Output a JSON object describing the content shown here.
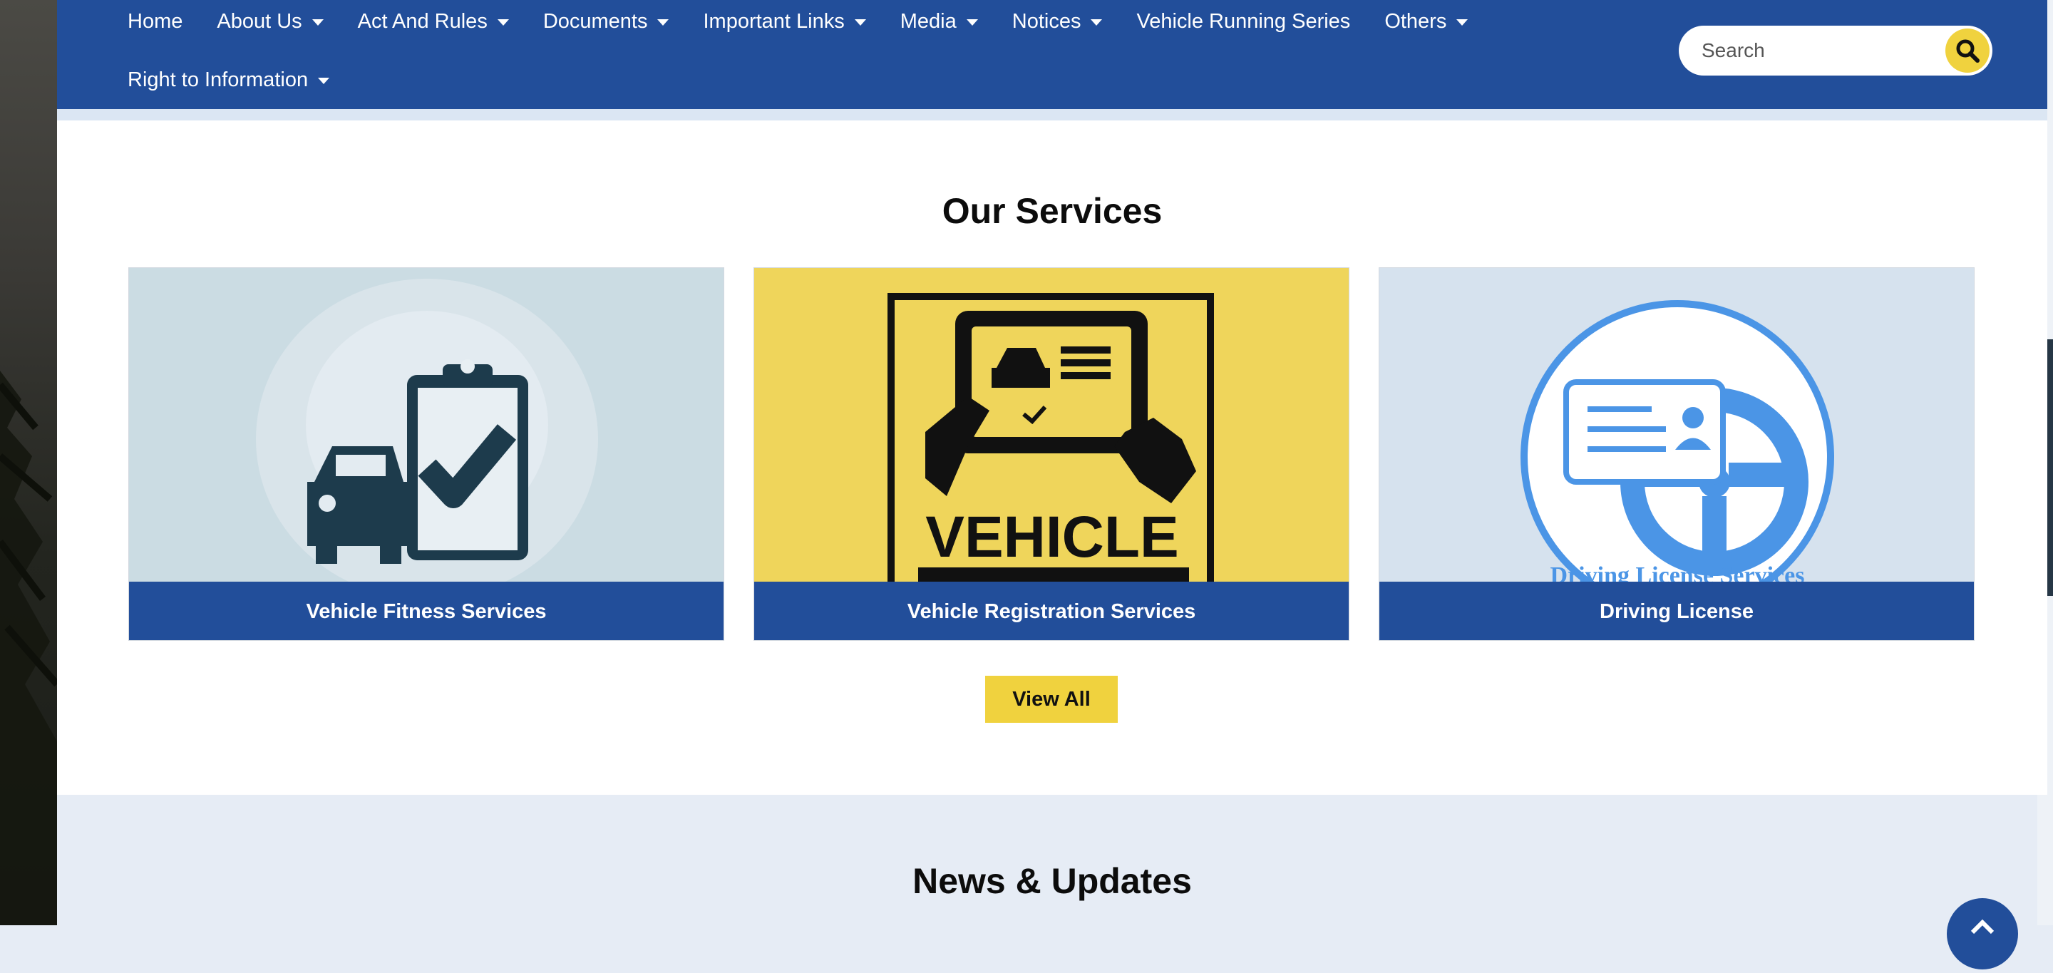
{
  "nav": {
    "items": [
      {
        "label": "Home",
        "dropdown": false
      },
      {
        "label": "About Us",
        "dropdown": true
      },
      {
        "label": "Act And Rules",
        "dropdown": true
      },
      {
        "label": "Documents",
        "dropdown": true
      },
      {
        "label": "Important Links",
        "dropdown": true
      },
      {
        "label": "Media",
        "dropdown": true
      },
      {
        "label": "Notices",
        "dropdown": true
      },
      {
        "label": "Vehicle Running Series",
        "dropdown": false
      },
      {
        "label": "Others",
        "dropdown": true
      },
      {
        "label": "Right to Information",
        "dropdown": true
      }
    ],
    "search_placeholder": "Search",
    "search_icon": "search-icon"
  },
  "services": {
    "title": "Our Services",
    "cards": [
      {
        "caption": "Vehicle Fitness Services",
        "icon": "car-clipboard-check-icon"
      },
      {
        "caption": "Vehicle Registration Services",
        "image_text": "VEHICLE",
        "icon": "vehicle-registration-icon"
      },
      {
        "caption": "Driving License",
        "image_text": "Driving License Services",
        "icon": "license-steering-icon"
      }
    ],
    "view_all_label": "View All"
  },
  "news": {
    "title": "News & Updates"
  },
  "colors": {
    "brand_blue": "#224e9a",
    "accent_yellow": "#f0d23e",
    "section_bg": "#e6ecf5"
  }
}
